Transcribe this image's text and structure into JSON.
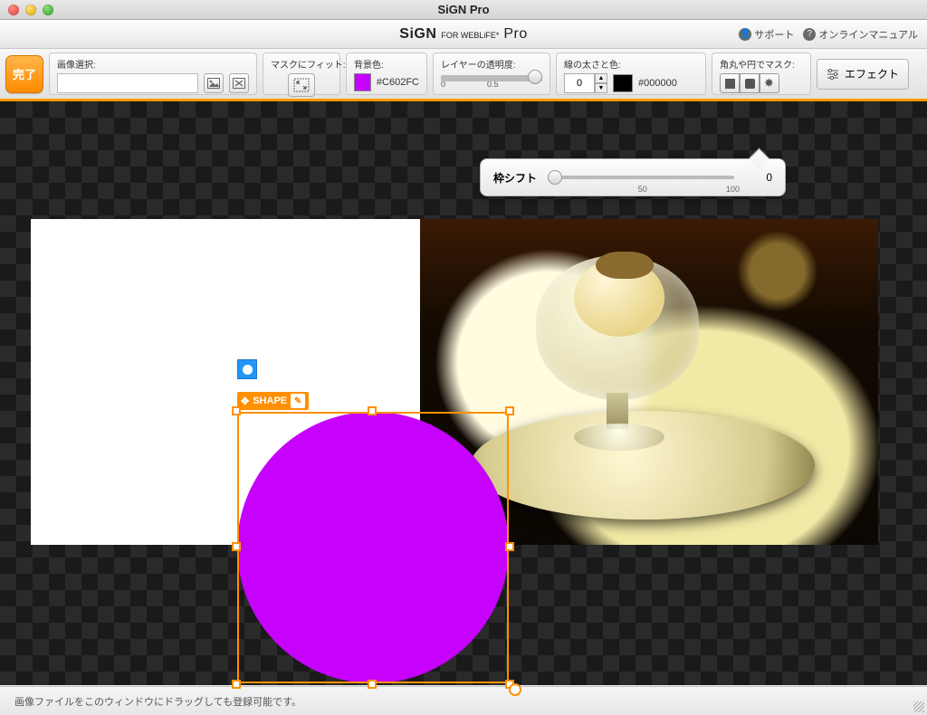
{
  "window": {
    "title": "SiGN Pro"
  },
  "brand": {
    "name_strong": "SiGN",
    "name_sub": "FOR WEBLiFE*",
    "name_suffix": "Pro"
  },
  "links": {
    "support": "サポート",
    "manual": "オンラインマニュアル"
  },
  "toolbar": {
    "done": "完了",
    "image_select_label": "画像選択:",
    "image_select_value": "",
    "fit_label": "マスクにフィット:",
    "bg_label": "背景色:",
    "bg_hex": "#C602FC",
    "opacity_label": "レイヤーの透明度:",
    "opacity_min": "0",
    "opacity_mid": "0.5",
    "line_label": "線の太さと色:",
    "line_width": "0",
    "line_hex": "#000000",
    "mask_label": "角丸や円でマスク:",
    "effect": "エフェクト"
  },
  "shift": {
    "label": "枠シフト",
    "value": "0",
    "mid": "50",
    "max": "100"
  },
  "selection": {
    "label": "SHAPE"
  },
  "footer": {
    "hint": "画像ファイルをこのウィンドウにドラッグしても登録可能です。"
  }
}
